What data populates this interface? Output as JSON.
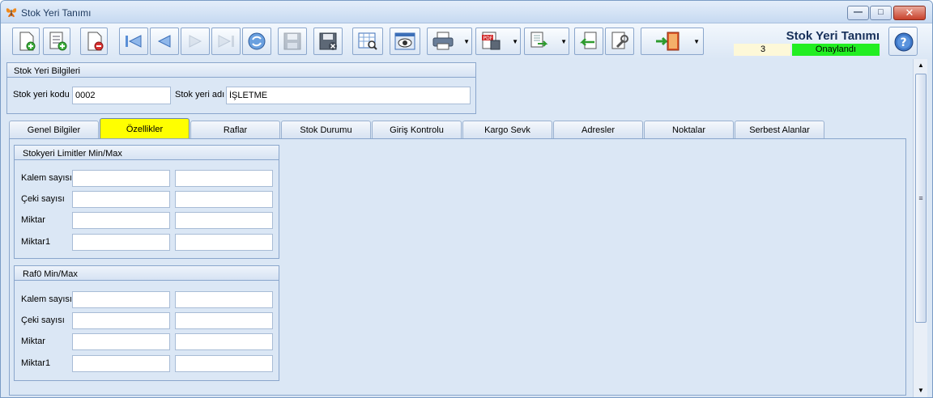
{
  "window": {
    "title": "Stok Yeri Tanımı"
  },
  "header": {
    "title": "Stok Yeri Tanımı",
    "record_no": "3",
    "status": "Onaylandı",
    "status_color": "#22ee22"
  },
  "toolbar": {
    "buttons": [
      {
        "icon": "new-document-icon"
      },
      {
        "icon": "new-list-add-icon"
      },
      {
        "icon": "delete-document-icon"
      },
      {
        "icon": "first-record-icon"
      },
      {
        "icon": "previous-record-icon"
      },
      {
        "icon": "next-record-icon"
      },
      {
        "icon": "last-record-icon"
      },
      {
        "icon": "refresh-icon"
      },
      {
        "icon": "save-icon"
      },
      {
        "icon": "cancel-save-icon"
      },
      {
        "icon": "preview-grid-icon"
      },
      {
        "icon": "view-eye-icon"
      },
      {
        "icon": "print-icon"
      },
      {
        "icon": "pdf-export-icon"
      },
      {
        "icon": "export-document-icon"
      },
      {
        "icon": "import-document-icon"
      },
      {
        "icon": "settings-tool-icon"
      },
      {
        "icon": "exit-door-icon"
      },
      {
        "icon": "help-icon"
      }
    ]
  },
  "general_panel": {
    "title": "Stok Yeri Bilgileri",
    "code_label": "Stok yeri kodu",
    "code_value": "0002",
    "name_label": "Stok yeri adı",
    "name_value": "İŞLETME"
  },
  "tabs": [
    {
      "label": "Genel Bilgiler"
    },
    {
      "label": "Özellikler",
      "active": true
    },
    {
      "label": "Raflar"
    },
    {
      "label": "Stok Durumu"
    },
    {
      "label": "Giriş Kontrolu"
    },
    {
      "label": "Kargo Sevk"
    },
    {
      "label": "Adresler"
    },
    {
      "label": "Noktalar"
    },
    {
      "label": "Serbest Alanlar"
    }
  ],
  "active_tab_color": "#ffff00",
  "groups": [
    {
      "title": "Stokyeri Limitler Min/Max",
      "rows": [
        {
          "label": "Kalem sayısı"
        },
        {
          "label": "Çeki sayısı"
        },
        {
          "label": "Miktar"
        },
        {
          "label": "Miktar1"
        }
      ]
    },
    {
      "title": "Raf0 Min/Max",
      "rows": [
        {
          "label": "Kalem sayısı"
        },
        {
          "label": "Çeki sayısı"
        },
        {
          "label": "Miktar"
        },
        {
          "label": "Miktar1"
        }
      ]
    }
  ]
}
